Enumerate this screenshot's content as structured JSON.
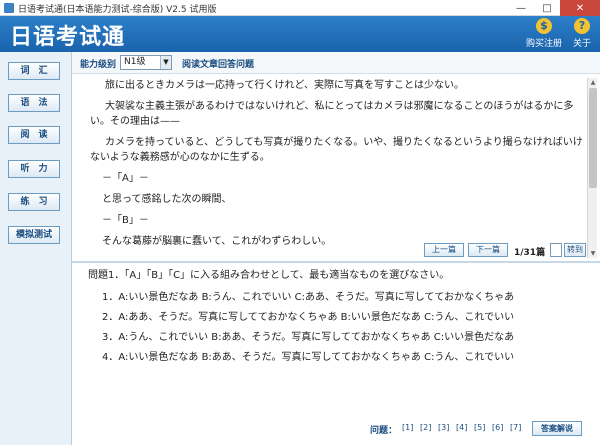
{
  "window": {
    "title": "日语考试通(日本语能力测试-综合版) V2.5 试用版",
    "min_glyph": "—",
    "max_glyph": "□",
    "close_glyph": "✕"
  },
  "header": {
    "app_title": "日语考试通",
    "buy_label": "购买注册",
    "about_label": "关于",
    "buy_icon_glyph": "$",
    "about_icon_glyph": "?"
  },
  "sidebar": {
    "items": [
      {
        "label": "词　汇"
      },
      {
        "label": "语　法"
      },
      {
        "label": "阅　读"
      },
      {
        "label": "听　力"
      },
      {
        "label": "练　习"
      },
      {
        "label": "模拟测试"
      }
    ]
  },
  "toolbar": {
    "level_label": "能力级别",
    "level_value": "N1级",
    "desc": "阅读文章回答问题"
  },
  "passage": {
    "paragraphs": [
      "旅に出るときカメラは一応持って行くけれど、実際に写真を写すことは少ない。",
      "大袈裟な主義主張があるわけではないけれど、私にとってはカメラは邪魔になることのほうがはるかに多い。その理由は——",
      "カメラを持っていると、どうしても写真が撮りたくなる。いや、撮りたくなるというより撮らなければいけないような義務感が心のなかに生ずる。",
      "－「A」－",
      "と思って感銘した次の瞬間、",
      "－「B」－",
      "そんな葛藤が脳裏に蠢いて、これがわずらわしい。"
    ]
  },
  "pager": {
    "prev_label": "上一篇",
    "next_label": "下一篇",
    "count": "1/31篇",
    "goto_label": "转到"
  },
  "question": {
    "title": "問題1．「A」「B」「C」に入る組み合わせとして、最も適当なものを選びなさい。",
    "options": [
      "1．A:いい景色だなあ B:うん、これでいい C:ああ、そうだ。写真に写してておかなくちゃあ",
      "2．A:ああ、そうだ。写真に写してておかなくちゃあ B:いい景色だなあ C:うん、これでいい",
      "3．A:うん、これでいい B:ああ、そうだ。写真に写してておかなくちゃあ C:いい景色だなあ",
      "4．A:いい景色だなあ B:ああ、そうだ。写真に写してておかなくちゃあ C:うん、これでいい"
    ]
  },
  "footer": {
    "question_label": "问题：",
    "links": [
      "[1]",
      "[2]",
      "[3]",
      "[4]",
      "[5]",
      "[6]",
      "[7]"
    ],
    "answer_button": "答案解说"
  }
}
